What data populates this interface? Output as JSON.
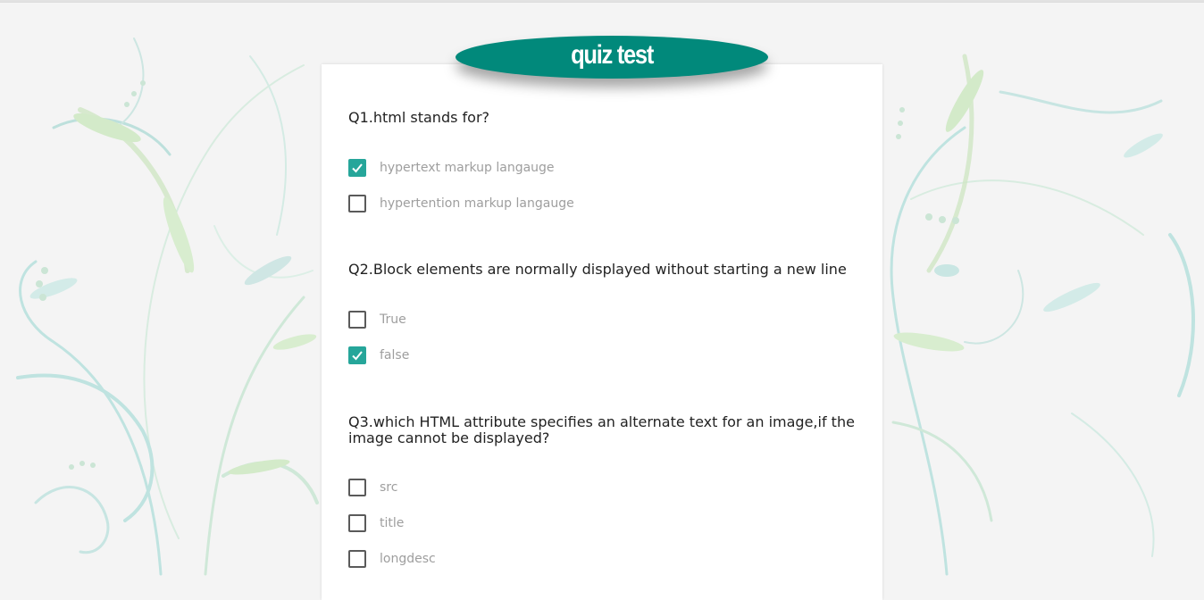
{
  "header": {
    "title": "quiz test",
    "accent_color": "#01897b",
    "checkbox_color": "#26a69a"
  },
  "questions": [
    {
      "text": "Q1.html stands for?",
      "options": [
        {
          "label": "hypertext markup langauge",
          "checked": true
        },
        {
          "label": "hypertention markup langauge",
          "checked": false
        }
      ]
    },
    {
      "text": "Q2.Block elements are normally displayed without starting a new line",
      "options": [
        {
          "label": "True",
          "checked": false
        },
        {
          "label": "false",
          "checked": true
        }
      ]
    },
    {
      "text": "Q3.which HTML attribute specifies an alternate text for an image,if the image cannot be displayed?",
      "options": [
        {
          "label": "src",
          "checked": false
        },
        {
          "label": "title",
          "checked": false
        },
        {
          "label": "longdesc",
          "checked": false
        }
      ]
    }
  ]
}
